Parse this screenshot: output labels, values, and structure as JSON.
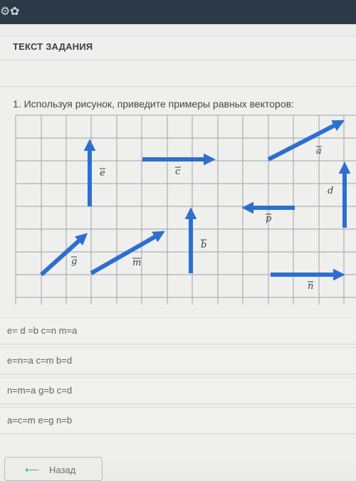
{
  "header": {
    "icons": [
      "settings-icon",
      "globe-icon"
    ]
  },
  "task": {
    "title": "ТЕКСТ ЗАДАНИЯ",
    "question": "1. Используя рисунок, приведите примеры равных векторов:"
  },
  "figure": {
    "vectors": [
      {
        "name": "e",
        "label": "e"
      },
      {
        "name": "c",
        "label": "c"
      },
      {
        "name": "a",
        "label": "a"
      },
      {
        "name": "d",
        "label": "d"
      },
      {
        "name": "p",
        "label": "p"
      },
      {
        "name": "g",
        "label": "g"
      },
      {
        "name": "m",
        "label": "m"
      },
      {
        "name": "b",
        "label": "b"
      },
      {
        "name": "n",
        "label": "n"
      }
    ],
    "colors": {
      "vector": "#2d6fd0",
      "grid": "#9ea3a8"
    }
  },
  "answers": [
    {
      "text": "e= d =b c=n m=a"
    },
    {
      "text": "e=n=a c=m b=d"
    },
    {
      "text": "n=m=a g=b c=d"
    },
    {
      "text": "a=c=m e=g n=b"
    }
  ],
  "nav": {
    "back_label": "Назад"
  }
}
